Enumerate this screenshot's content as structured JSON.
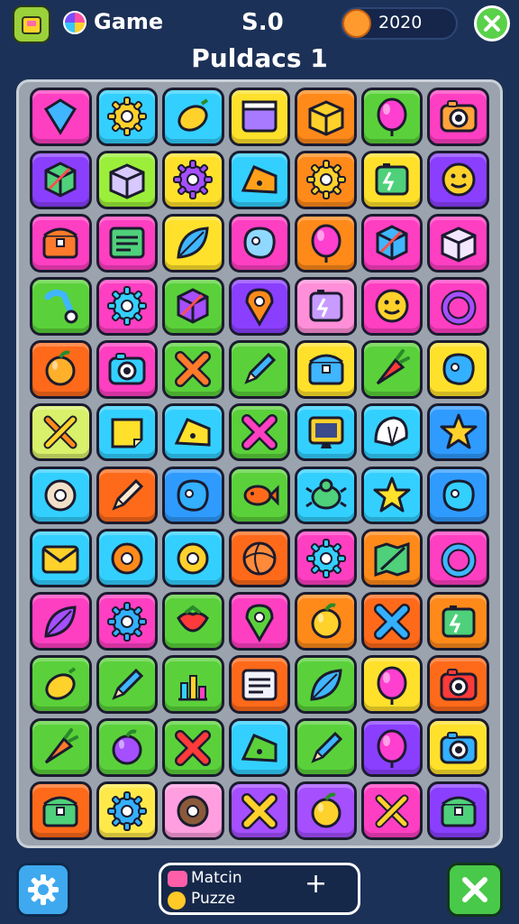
{
  "header": {
    "game_label": "Game",
    "score": "S.0",
    "coins": "2020",
    "level_title": "Puldacs 1"
  },
  "footer": {
    "mode_line1": "Matcin",
    "mode_line2": "Puzze",
    "plus_label": "+"
  },
  "colors": {
    "background": "#1c3157",
    "board": "#9aa3ae",
    "accent_green": "#49c94a"
  },
  "board": {
    "columns": 7,
    "rows": [
      [
        {
          "bg": "#ff3fc2",
          "icon": "gem-icon",
          "color": "#3fb6ff"
        },
        {
          "bg": "#33d0ff",
          "icon": "gear-icon",
          "color": "#ffd12b"
        },
        {
          "bg": "#33d0ff",
          "icon": "lemon-icon",
          "color": "#ffd12b"
        },
        {
          "bg": "#ffe12b",
          "icon": "window-icon",
          "color": "#a77aff"
        },
        {
          "bg": "#ff8a1a",
          "icon": "box-icon",
          "color": "#ffd12b"
        },
        {
          "bg": "#5ad13a",
          "icon": "balloon-icon",
          "color": "#ff3fd0"
        },
        {
          "bg": "#ff3fc2",
          "icon": "camera-icon",
          "color": "#ffa33a"
        }
      ],
      [
        {
          "bg": "#8a3fff",
          "icon": "cube-icon",
          "color": "#4fd07a"
        },
        {
          "bg": "#9bef3a",
          "icon": "box-icon",
          "color": "#d7c8ff"
        },
        {
          "bg": "#ffe12b",
          "icon": "gear-icon",
          "color": "#a54fff"
        },
        {
          "bg": "#33d0ff",
          "icon": "cheese-icon",
          "color": "#ffa01a"
        },
        {
          "bg": "#ff8a1a",
          "icon": "gear-icon",
          "color": "#ffd12b"
        },
        {
          "bg": "#ffe12b",
          "icon": "battery-icon",
          "color": "#4fd07a"
        },
        {
          "bg": "#8a3fff",
          "icon": "face-icon",
          "color": "#ffd12b"
        }
      ],
      [
        {
          "bg": "#ff3fc2",
          "icon": "chest-icon",
          "color": "#ff7a2a"
        },
        {
          "bg": "#ff3fc2",
          "icon": "list-icon",
          "color": "#4fd07a"
        },
        {
          "bg": "#ffe12b",
          "icon": "leaf-icon",
          "color": "#3fb6ff"
        },
        {
          "bg": "#ff3fc2",
          "icon": "blob-icon",
          "color": "#8fd8ff"
        },
        {
          "bg": "#ff8a1a",
          "icon": "balloon-icon",
          "color": "#ff3fd0"
        },
        {
          "bg": "#ff3fc2",
          "icon": "cube-icon",
          "color": "#3fb6ff"
        },
        {
          "bg": "#ff3fc2",
          "icon": "box-icon",
          "color": "#f2e7ff"
        }
      ],
      [
        {
          "bg": "#5ad13a",
          "icon": "wand-icon",
          "color": "#3fb6ff"
        },
        {
          "bg": "#ff3fc2",
          "icon": "gear-icon",
          "color": "#33d0ff"
        },
        {
          "bg": "#5ad13a",
          "icon": "cube-icon",
          "color": "#a54fff"
        },
        {
          "bg": "#8a3fff",
          "icon": "pin-icon",
          "color": "#ff8a1a"
        },
        {
          "bg": "#ff8fd8",
          "icon": "battery-icon",
          "color": "#c79bff"
        },
        {
          "bg": "#ff3fc2",
          "icon": "face-icon",
          "color": "#ffd12b"
        },
        {
          "bg": "#ff3fc2",
          "icon": "ring-icon",
          "color": "#a54fff"
        }
      ],
      [
        {
          "bg": "#ff6a1a",
          "icon": "fruit-icon",
          "color": "#ffb02a"
        },
        {
          "bg": "#ff3fc2",
          "icon": "camera-icon",
          "color": "#33d0ff"
        },
        {
          "bg": "#5ad13a",
          "icon": "cross-icon",
          "color": "#ff7a2a"
        },
        {
          "bg": "#5ad13a",
          "icon": "pencil-icon",
          "color": "#3fb6ff"
        },
        {
          "bg": "#ffe12b",
          "icon": "chest-icon",
          "color": "#3fb6ff"
        },
        {
          "bg": "#5ad13a",
          "icon": "carrot-icon",
          "color": "#ff3a3a"
        },
        {
          "bg": "#ffe12b",
          "icon": "blob-icon",
          "color": "#33b0ff"
        }
      ],
      [
        {
          "bg": "#d8f06a",
          "icon": "crossed-tools-icon",
          "color": "#ff8a1a"
        },
        {
          "bg": "#33d0ff",
          "icon": "note-icon",
          "color": "#ffe12b"
        },
        {
          "bg": "#33d0ff",
          "icon": "cheese-icon",
          "color": "#ffe12b"
        },
        {
          "bg": "#5ad13a",
          "icon": "cross-icon",
          "color": "#ff3fc2"
        },
        {
          "bg": "#33d0ff",
          "icon": "screen-icon",
          "color": "#ffd12b"
        },
        {
          "bg": "#33d0ff",
          "icon": "shell-icon",
          "color": "#ffffff"
        },
        {
          "bg": "#2f9bff",
          "icon": "star-icon",
          "color": "#ffd12b"
        }
      ],
      [
        {
          "bg": "#33d0ff",
          "icon": "donut-icon",
          "color": "#f2e0c8"
        },
        {
          "bg": "#ff6a1a",
          "icon": "pencil-icon",
          "color": "#ffe9d0"
        },
        {
          "bg": "#2f9bff",
          "icon": "blob-icon",
          "color": "#33b0ff"
        },
        {
          "bg": "#5ad13a",
          "icon": "fish-icon",
          "color": "#ff6a1a"
        },
        {
          "bg": "#33d0ff",
          "icon": "beetle-icon",
          "color": "#4fd07a"
        },
        {
          "bg": "#33d0ff",
          "icon": "star-icon",
          "color": "#ffe12b"
        },
        {
          "bg": "#2f9bff",
          "icon": "blob-icon",
          "color": "#33d0ff"
        }
      ],
      [
        {
          "bg": "#33d0ff",
          "icon": "envelope-icon",
          "color": "#ffd12b"
        },
        {
          "bg": "#33d0ff",
          "icon": "donut-icon",
          "color": "#ff8a1a"
        },
        {
          "bg": "#33d0ff",
          "icon": "donut-icon",
          "color": "#ffd12b"
        },
        {
          "bg": "#ff6a1a",
          "icon": "ball-icon",
          "color": "#ff8a3a"
        },
        {
          "bg": "#ff3fc2",
          "icon": "gear-icon",
          "color": "#33d0ff"
        },
        {
          "bg": "#ff8a1a",
          "icon": "map-icon",
          "color": "#4fd07a"
        },
        {
          "bg": "#ff3fc2",
          "icon": "ring-icon",
          "color": "#3fb6ff"
        }
      ],
      [
        {
          "bg": "#ff3fc2",
          "icon": "leaf-icon",
          "color": "#a54fff"
        },
        {
          "bg": "#ff3fc2",
          "icon": "gear-icon",
          "color": "#33b0ff"
        },
        {
          "bg": "#5ad13a",
          "icon": "strawberry-icon",
          "color": "#ff3a3a"
        },
        {
          "bg": "#ff3fc2",
          "icon": "pin-icon",
          "color": "#5ad13a"
        },
        {
          "bg": "#ff8a1a",
          "icon": "fruit-icon",
          "color": "#ffd12b"
        },
        {
          "bg": "#ff6a1a",
          "icon": "cross-icon",
          "color": "#33b0ff"
        },
        {
          "bg": "#ff8a1a",
          "icon": "battery-icon",
          "color": "#4fd07a"
        }
      ],
      [
        {
          "bg": "#5ad13a",
          "icon": "lemon-icon",
          "color": "#ffd12b"
        },
        {
          "bg": "#5ad13a",
          "icon": "pencil-icon",
          "color": "#3fb6ff"
        },
        {
          "bg": "#5ad13a",
          "icon": "chart-icon",
          "color": "#33d0ff"
        },
        {
          "bg": "#ff6a1a",
          "icon": "list-icon",
          "color": "#f2f2ff"
        },
        {
          "bg": "#5ad13a",
          "icon": "leaf-icon",
          "color": "#3fb6ff"
        },
        {
          "bg": "#ffe12b",
          "icon": "balloon-icon",
          "color": "#ff3fd0"
        },
        {
          "bg": "#ff6a1a",
          "icon": "camera-icon",
          "color": "#ff3a3a"
        }
      ],
      [
        {
          "bg": "#5ad13a",
          "icon": "carrot-icon",
          "color": "#ff7a2a"
        },
        {
          "bg": "#5ad13a",
          "icon": "fruit-icon",
          "color": "#a54fff"
        },
        {
          "bg": "#5ad13a",
          "icon": "cross-icon",
          "color": "#ff3a3a"
        },
        {
          "bg": "#33d0ff",
          "icon": "cheese-icon",
          "color": "#5ad13a"
        },
        {
          "bg": "#5ad13a",
          "icon": "pencil-icon",
          "color": "#3fb6ff"
        },
        {
          "bg": "#8a3fff",
          "icon": "balloon-icon",
          "color": "#ff3fd0"
        },
        {
          "bg": "#ffe12b",
          "icon": "camera-icon",
          "color": "#33b0ff"
        }
      ],
      [
        {
          "bg": "#ff6a1a",
          "icon": "chest-icon",
          "color": "#4fd07a"
        },
        {
          "bg": "#ffe94a",
          "icon": "gear-icon",
          "color": "#33b0ff"
        },
        {
          "bg": "#ff9fe0",
          "icon": "donut-icon",
          "color": "#8a5a3a"
        },
        {
          "bg": "#a54fff",
          "icon": "cross-icon",
          "color": "#ffd12b"
        },
        {
          "bg": "#a54fff",
          "icon": "fruit-icon",
          "color": "#ffd12b"
        },
        {
          "bg": "#ff3fc2",
          "icon": "crossed-tools-icon",
          "color": "#ffd12b"
        },
        {
          "bg": "#8a3fff",
          "icon": "chest-icon",
          "color": "#4fd07a"
        }
      ]
    ]
  }
}
